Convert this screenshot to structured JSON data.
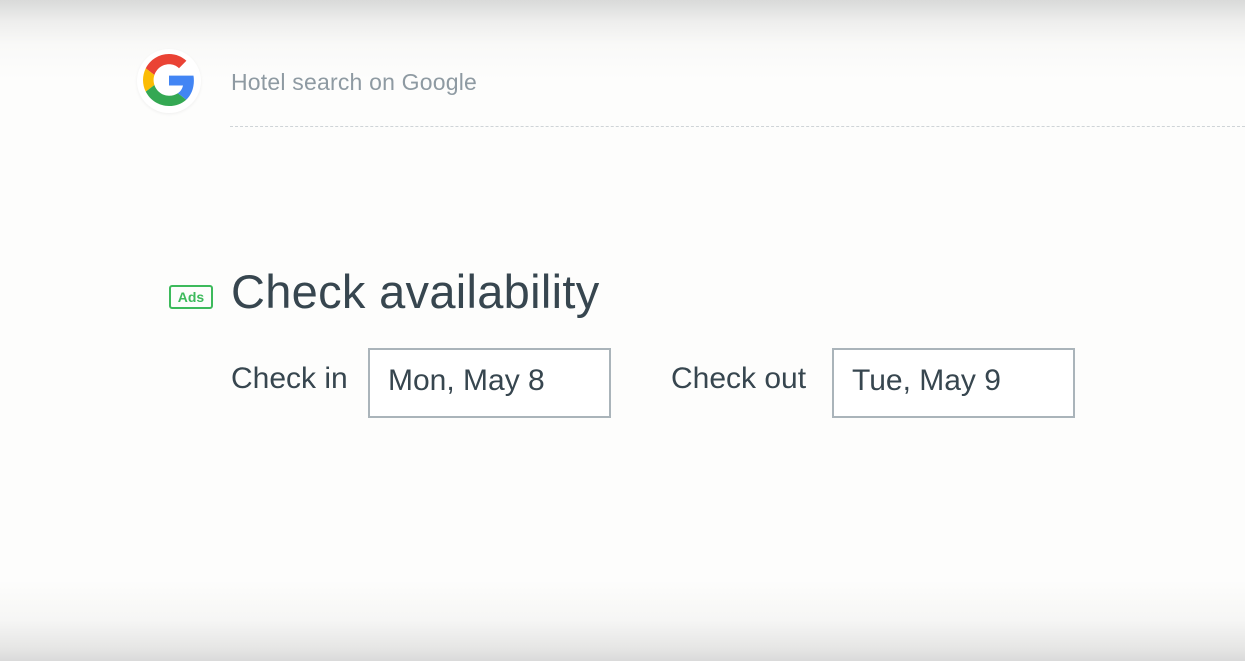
{
  "header": {
    "logo_icon": "google-g-icon",
    "title": "Hotel search on Google"
  },
  "main": {
    "badge": "Ads",
    "title": "Check availability",
    "check_in": {
      "label": "Check in",
      "value": "Mon, May 8"
    },
    "check_out": {
      "label": "Check out",
      "value": "Tue, May 9"
    }
  },
  "colors": {
    "ads_green": "#3dba5c",
    "text_dark": "#37464f",
    "text_muted": "#8e9aa2",
    "box_border": "#aab4ba",
    "google_blue": "#4285f4",
    "google_red": "#ea4335",
    "google_yellow": "#fbbc05",
    "google_green": "#34a853"
  }
}
